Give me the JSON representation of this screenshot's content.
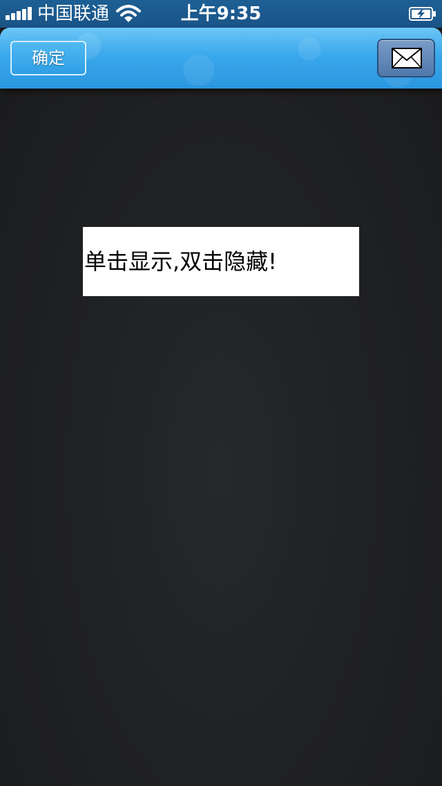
{
  "status_bar": {
    "carrier": "中国联通",
    "time": "上午9:35",
    "icons": [
      "signal-icon",
      "wifi-icon",
      "battery-charging-icon"
    ]
  },
  "nav_bar": {
    "confirm_label": "确定",
    "mail_icon": "envelope-icon",
    "accent_color": "#3aa8ec"
  },
  "toast": {
    "text": "单击显示,双击隐藏!"
  }
}
